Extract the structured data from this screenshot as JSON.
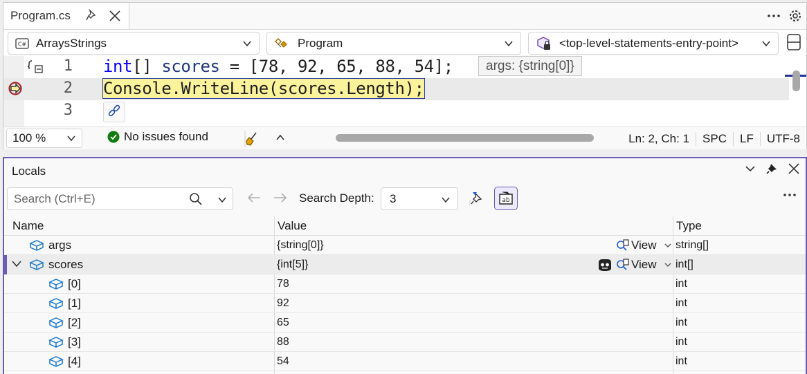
{
  "editor": {
    "tab_title": "Program.cs",
    "nav": {
      "project": "ArraysStrings",
      "class": "Program",
      "member": "<top-level-statements-entry-point>"
    },
    "lines": [
      {
        "number": "1",
        "code": "int[] scores = [78, 92, 65, 88, 54];"
      },
      {
        "number": "2",
        "code": "Console.WriteLine(scores.Length);"
      },
      {
        "number": "3",
        "code": ""
      }
    ],
    "datatip": "args: {string[0]}",
    "status": {
      "zoom": "100 %",
      "issues": "No issues found",
      "position": "Ln: 2, Ch: 1",
      "whitespace": "SPC",
      "line_ending": "LF",
      "encoding": "UTF-8"
    }
  },
  "locals": {
    "title": "Locals",
    "search_placeholder": "Search (Ctrl+E)",
    "search_depth_label": "Search Depth:",
    "search_depth_value": "3",
    "columns": {
      "name": "Name",
      "value": "Value",
      "type": "Type"
    },
    "view_label": "View",
    "rows": [
      {
        "name": "args",
        "value": "{string[0]}",
        "type": "string[]"
      },
      {
        "name": "scores",
        "value": "{int[5]}",
        "type": "int[]"
      },
      {
        "name": "[0]",
        "value": "78",
        "type": "int"
      },
      {
        "name": "[1]",
        "value": "92",
        "type": "int"
      },
      {
        "name": "[2]",
        "value": "65",
        "type": "int"
      },
      {
        "name": "[3]",
        "value": "88",
        "type": "int"
      },
      {
        "name": "[4]",
        "value": "54",
        "type": "int"
      }
    ]
  },
  "colors": {
    "accent": "#6b5bb5",
    "current_statement": "#fbf29c",
    "keyword": "#0000ff",
    "identifier": "#1f377f",
    "success": "#107c10"
  }
}
